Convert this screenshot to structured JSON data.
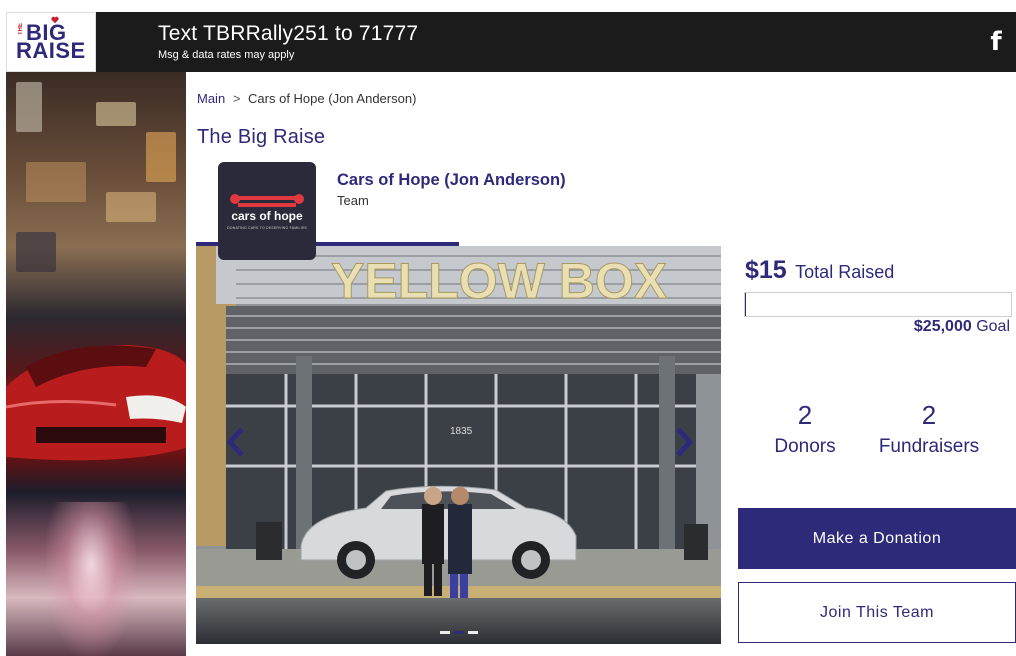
{
  "header": {
    "logo": {
      "line1": "BIG",
      "line2": "RAISE",
      "prefix": "THE",
      "icon": "heart-icon"
    },
    "promo_text": "Text TBRRally251 to 71777",
    "promo_subtext": "Msg & data rates may apply",
    "social_icon": "facebook-icon",
    "social_label": "f"
  },
  "breadcrumb": {
    "root": "Main",
    "separator": ">",
    "current": "Cars of Hope (Jon Anderson)"
  },
  "organization_title": "The Big Raise",
  "team": {
    "name": "Cars of Hope (Jon Anderson)",
    "type": "Team",
    "logo_name": "cars of hope",
    "logo_tagline": "DONATING CARS TO DESERVING FAMILIES"
  },
  "photo": {
    "sign_text": "YELLOW BOX",
    "address_number": "1835",
    "slides_count": 3,
    "active_slide": 2,
    "prev_icon": "chevron-left-icon",
    "next_icon": "chevron-right-icon"
  },
  "stats": {
    "total_raised_amount": "$15",
    "total_raised_label": "Total Raised",
    "progress_fraction": 0.0006,
    "goal_amount": "$25,000",
    "goal_label": "Goal",
    "donors_count": "2",
    "donors_label": "Donors",
    "fundraisers_count": "2",
    "fundraisers_label": "Fundraisers"
  },
  "actions": {
    "donate_label": "Make a Donation",
    "join_label": "Join This Team"
  },
  "colors": {
    "brand": "#2e2a7a",
    "accent": "#e0393f",
    "header_bg": "#1b1b1b"
  }
}
